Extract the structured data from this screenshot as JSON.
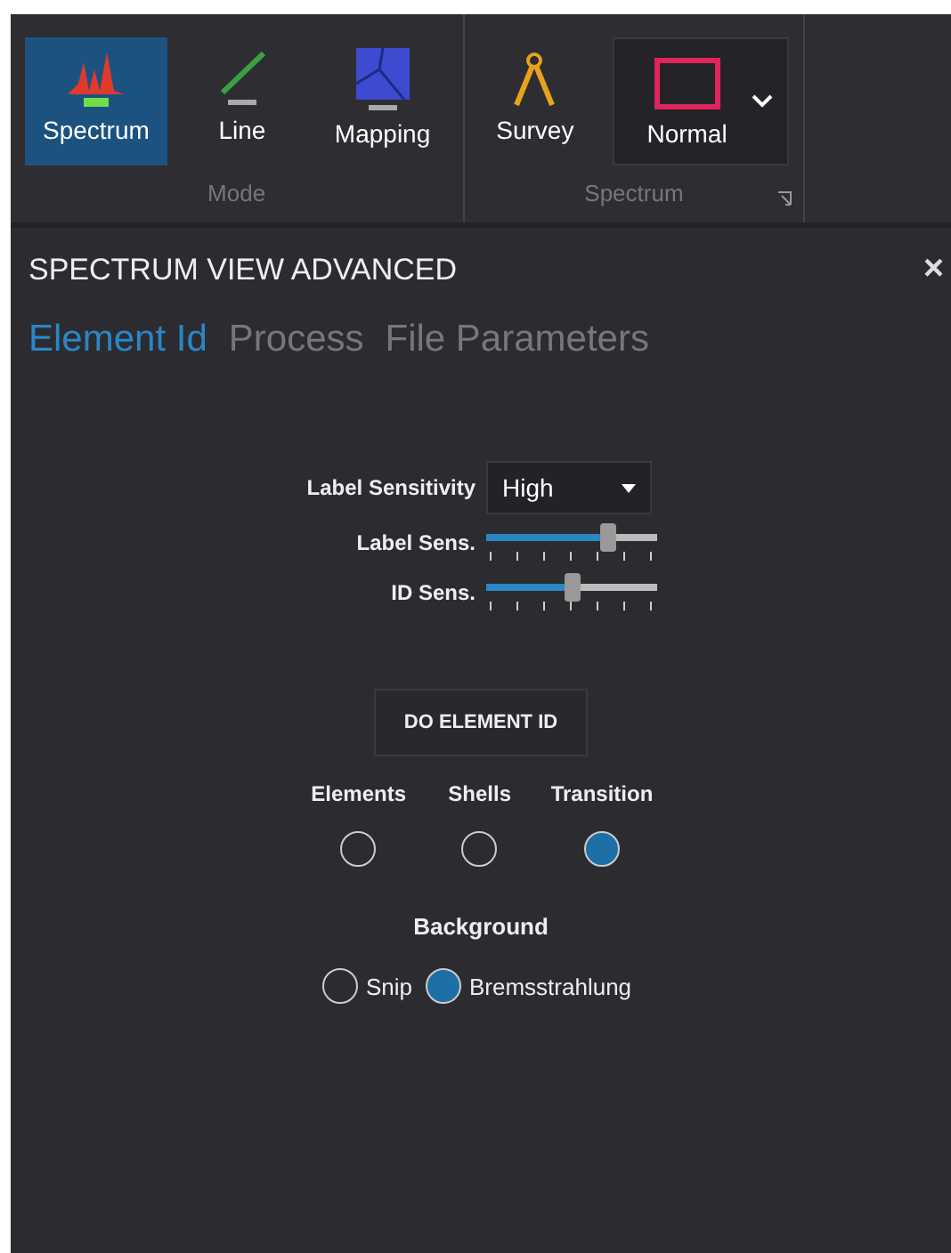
{
  "ribbon": {
    "groups": [
      {
        "label": "Mode",
        "launcher": false,
        "items": [
          {
            "kind": "spectrum",
            "label": "Spectrum",
            "selected": true
          },
          {
            "kind": "line",
            "label": "Line",
            "selected": false
          },
          {
            "kind": "mapping",
            "label": "Mapping",
            "selected": false
          }
        ]
      },
      {
        "label": "Spectrum",
        "launcher": true,
        "items": [
          {
            "kind": "survey",
            "label": "Survey",
            "selected": false
          },
          {
            "kind": "normal",
            "label": "Normal",
            "selected": false
          }
        ]
      }
    ]
  },
  "panel": {
    "title": "SPECTRUM VIEW ADVANCED",
    "close": "×",
    "tabs": [
      {
        "label": "Element Id",
        "selected": true
      },
      {
        "label": "Process",
        "selected": false
      },
      {
        "label": "File Parameters",
        "selected": false
      }
    ],
    "label_sensitivity": {
      "label": "Label Sensitivity",
      "value": "High"
    },
    "sliders": [
      {
        "label": "Label Sens.",
        "level": 0.71
      },
      {
        "label": "ID Sens.",
        "level": 0.5
      }
    ],
    "action_button": "DO ELEMENT ID",
    "id_mode": [
      {
        "label": "Elements",
        "selected": false
      },
      {
        "label": "Shells",
        "selected": false
      },
      {
        "label": "Transition",
        "selected": true
      }
    ],
    "background": {
      "label": "Background",
      "options": [
        {
          "label": "Snip",
          "selected": false
        },
        {
          "label": "Bremsstrahlung",
          "selected": true
        }
      ]
    }
  }
}
